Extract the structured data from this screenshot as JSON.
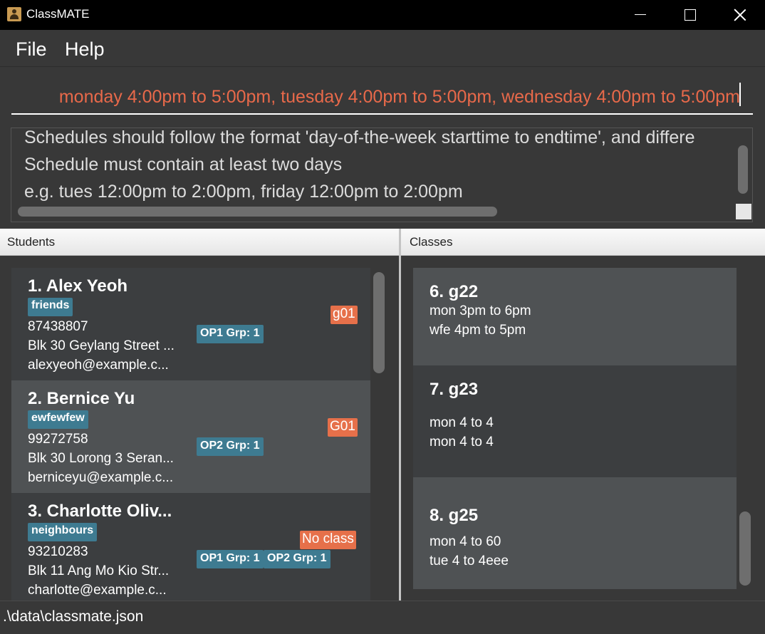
{
  "window": {
    "title": "ClassMATE"
  },
  "menu": {
    "file": "File",
    "help": "Help"
  },
  "command": {
    "value": "monday 4:00pm to 5:00pm, tuesday 4:00pm to 5:00pm, wednesday 4:00pm to 5:00pm"
  },
  "result": {
    "lines": [
      "Schedules should follow the format 'day-of-the-week starttime to endtime', and differe",
      "Schedule must contain at least two days",
      "e.g. tues 12:00pm to 2:00pm, friday 12:00pm to 2:00pm"
    ]
  },
  "panels": {
    "students_title": "Students",
    "classes_title": "Classes"
  },
  "students": [
    {
      "name": "1.  Alex Yeoh",
      "tag": "friends",
      "phone": "87438807",
      "address": "Blk 30 Geylang Street ...",
      "email": "alexyeoh@example.c...",
      "groups": [
        "OP1 Grp: 1"
      ],
      "class_code": "g01"
    },
    {
      "name": "2.  Bernice Yu",
      "tag": "ewfewfew",
      "phone": "99272758",
      "address": "Blk 30 Lorong 3 Seran...",
      "email": "berniceyu@example.c...",
      "groups": [
        "OP2 Grp: 1"
      ],
      "class_code": "G01"
    },
    {
      "name": "3.  Charlotte Oliv...",
      "tag": "neighbours",
      "phone": "93210283",
      "address": "Blk 11 Ang Mo Kio Str...",
      "email": "charlotte@example.c...",
      "groups": [
        "OP1 Grp: 1",
        "OP2 Grp: 1"
      ],
      "class_code": "No class"
    }
  ],
  "classes": [
    {
      "name": "6.  g22",
      "schedule_1": "mon 3pm to 6pm",
      "schedule_2": "wfe 4pm to 5pm"
    },
    {
      "name": "7.  g23",
      "schedule_1": "mon 4 to 4",
      "schedule_2": "mon 4 to 4"
    },
    {
      "name": "8.  g25",
      "schedule_1": "mon 4 to 60",
      "schedule_2": "tue 4 to 4eee"
    }
  ],
  "status": {
    "file_path": ".\\data\\classmate.json"
  },
  "colors": {
    "accent_orange": "#e6704a",
    "tag_teal": "#3e7b91",
    "command_text": "#e8694a",
    "background": "#383838"
  },
  "icons": {
    "app": "app-icon",
    "minimize": "minimize-icon",
    "maximize": "maximize-icon",
    "close": "close-icon"
  }
}
